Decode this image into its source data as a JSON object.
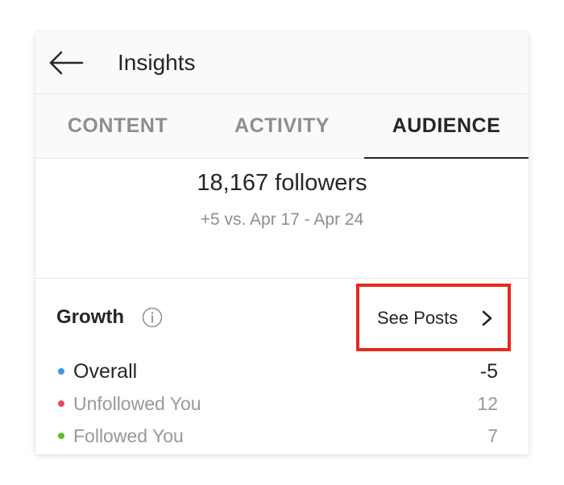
{
  "header": {
    "title": "Insights",
    "back_icon": "arrow-left-icon"
  },
  "tabs": [
    {
      "label": "CONTENT",
      "active": false
    },
    {
      "label": "ACTIVITY",
      "active": false
    },
    {
      "label": "AUDIENCE",
      "active": true
    }
  ],
  "summary": {
    "followers": "18,167 followers",
    "delta": "+5 vs. Apr 17 - Apr 24"
  },
  "growth": {
    "title": "Growth",
    "info_icon": "info-icon",
    "see_posts_label": "See Posts",
    "see_posts_icon": "chevron-right-icon",
    "highlight_color": "#e8291c",
    "rows": [
      {
        "label": "Overall",
        "value": "-5",
        "dot_color": "#3897f0"
      },
      {
        "label": "Unfollowed You",
        "value": "12",
        "dot_color": "#ed4956"
      },
      {
        "label": "Followed You",
        "value": "7",
        "dot_color": "#58c322"
      }
    ]
  }
}
